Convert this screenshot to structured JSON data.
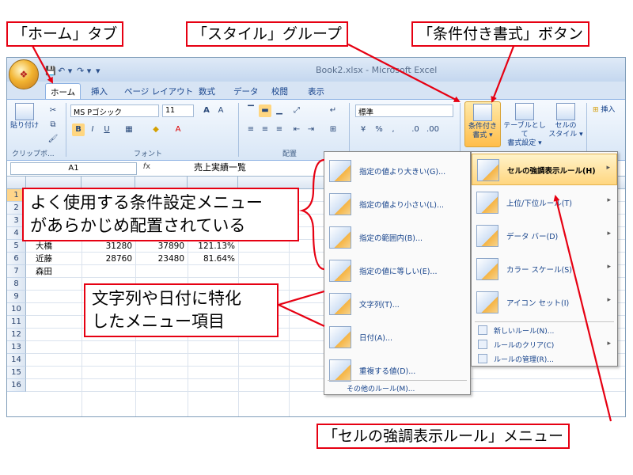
{
  "callouts": {
    "home_tab": "「ホーム」タブ",
    "style_group": "「スタイル」グループ",
    "cond_format_button": "「条件付き書式」ボタン",
    "frequent_menu_line1": "よく使用する条件設定メニュー",
    "frequent_menu_line2": "があらかじめ配置されている",
    "text_date_line1": "文字列や日付に特化",
    "text_date_line2": "したメニュー項目",
    "highlight_menu": "「セルの強調表示ルール」メニュー"
  },
  "window": {
    "title": "Book2.xlsx - Microsoft Excel"
  },
  "ribbon": {
    "tabs": [
      "ホーム",
      "挿入",
      "ページ レイアウト",
      "数式",
      "データ",
      "校閲",
      "表示"
    ],
    "active_tab": "ホーム",
    "font_name": "MS Pゴシック",
    "font_size": "11",
    "number_format": "標準",
    "paste_label": "貼り付け",
    "groups": {
      "clipboard": "クリップボ...",
      "font": "フォント",
      "alignment": "配置"
    },
    "style_buttons": {
      "cond_format": [
        "条件付き",
        "書式 ▾"
      ],
      "table_format": [
        "テーブルとして",
        "書式設定 ▾"
      ],
      "cell_style": [
        "セルの",
        "スタイル ▾"
      ]
    },
    "insert_label": "挿入"
  },
  "formula_bar": {
    "cell_ref": "A1",
    "value": "売上実績一覧"
  },
  "grid": {
    "rows": [
      "1",
      "2",
      "3",
      "4",
      "5",
      "6",
      "7",
      "8",
      "9",
      "10",
      "11",
      "12",
      "13",
      "14",
      "15",
      "16"
    ],
    "data": [
      {
        "row": 5,
        "name": "大橋",
        "v1": "31280",
        "v2": "37890",
        "pct": "121.13%"
      },
      {
        "row": 6,
        "name": "近藤",
        "v1": "28760",
        "v2": "23480",
        "pct": "81.64%"
      },
      {
        "row": 7,
        "name": "森田",
        "v1": "",
        "v2": "",
        "pct": ""
      }
    ]
  },
  "cond_menu": {
    "items": [
      {
        "label": "セルの強調表示ルール(H)",
        "has_submenu": true,
        "highlighted": true
      },
      {
        "label": "上位/下位ルール(T)",
        "has_submenu": true
      },
      {
        "label": "データ バー(D)",
        "has_submenu": true
      },
      {
        "label": "カラー スケール(S)",
        "has_submenu": true
      },
      {
        "label": "アイコン セット(I)",
        "has_submenu": true
      }
    ],
    "small_items": [
      {
        "label": "新しいルール(N)...",
        "has_submenu": false
      },
      {
        "label": "ルールのクリア(C)",
        "has_submenu": true
      },
      {
        "label": "ルールの管理(R)...",
        "has_submenu": false
      }
    ]
  },
  "highlight_submenu": {
    "items": [
      "指定の値より大きい(G)...",
      "指定の値より小さい(L)...",
      "指定の範囲内(B)...",
      "指定の値に等しい(E)...",
      "文字列(T)...",
      "日付(A)...",
      "重複する値(D)..."
    ],
    "footer": "その他のルール(M)..."
  },
  "colors": {
    "callout_border": "#e60012",
    "menu_highlight": "#ffd680",
    "ribbon_text": "#15428b"
  }
}
